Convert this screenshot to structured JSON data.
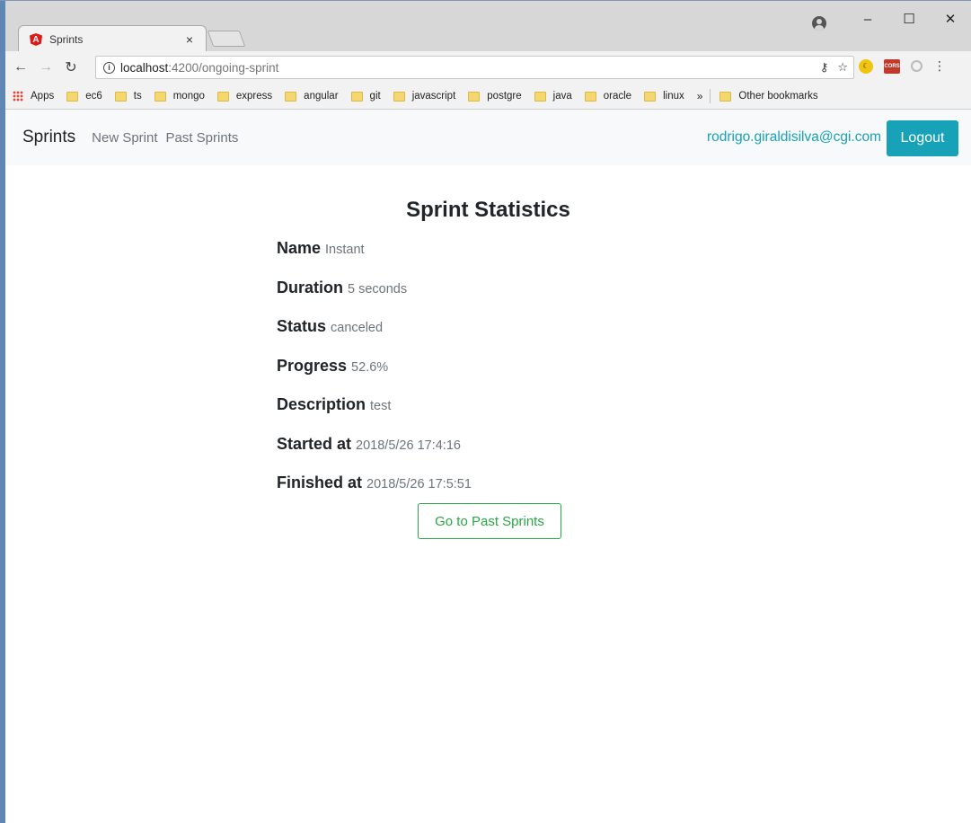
{
  "browser": {
    "tab_title": "Sprints",
    "tab_close": "×",
    "url_host": "localhost",
    "url_path": ":4200/ongoing-sprint",
    "window_controls": [
      "–",
      "☐",
      "✕"
    ],
    "bookmarks": {
      "apps": "Apps",
      "folders": [
        "ec6",
        "ts",
        "mongo",
        "express",
        "angular",
        "git",
        "javascript",
        "postgre",
        "java",
        "oracle",
        "linux"
      ],
      "more": "»",
      "other": "Other bookmarks"
    }
  },
  "navbar": {
    "brand": "Sprints",
    "links": [
      "New Sprint",
      "Past Sprints"
    ],
    "user_email": "rodrigo.giraldisilva@cgi.com",
    "logout_label": "Logout",
    "accent_color": "#17a2b8"
  },
  "main": {
    "title": "Sprint Statistics",
    "stats": [
      {
        "label": "Name",
        "value": "Instant"
      },
      {
        "label": "Duration",
        "value": "5 seconds"
      },
      {
        "label": "Status",
        "value": "canceled"
      },
      {
        "label": "Progress",
        "value": "52.6%"
      },
      {
        "label": "Description",
        "value": "test"
      },
      {
        "label": "Started at",
        "value": "2018/5/26 17:4:16"
      },
      {
        "label": "Finished at",
        "value": "2018/5/26 17:5:51"
      }
    ],
    "past_button_label": "Go to Past Sprints",
    "button_color": "#28a745"
  }
}
